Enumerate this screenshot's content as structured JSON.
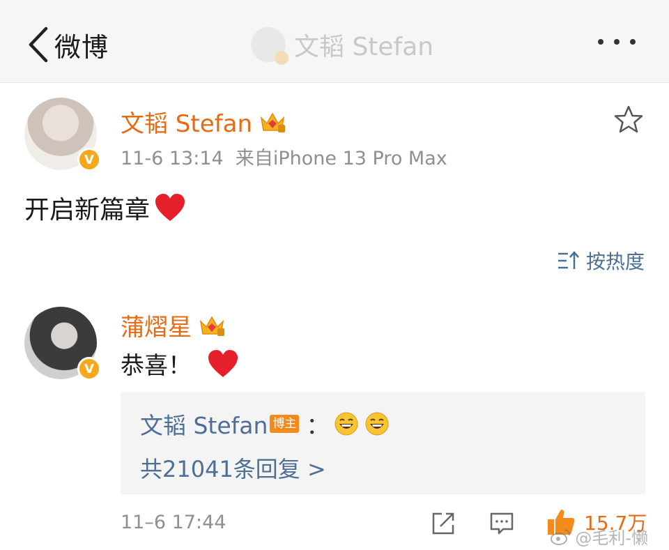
{
  "nav": {
    "back_label": "微博",
    "title": "文韬 Stefan"
  },
  "post": {
    "author": "文韬 Stefan",
    "time": "11-6 13:14",
    "source": "来自iPhone 13 Pro Max",
    "text": "开启新篇章"
  },
  "sort": {
    "label": "按热度"
  },
  "comment": {
    "author": "蒲熠星",
    "text": "恭喜！",
    "reply": {
      "author": "文韬 Stefan",
      "host_tag": "博主",
      "colon": "：",
      "count_text": "共21041条回复 >"
    },
    "time": "11–6 17:44",
    "likes": "15.7万"
  },
  "watermark": {
    "text": "@毛利-懒"
  },
  "colors": {
    "name_orange": "#e86a12",
    "link_blue": "#4d6e95",
    "verified": "#f6a81c"
  },
  "icons": [
    "chevron-left-icon",
    "more-dots-icon",
    "star-icon",
    "heart-icon",
    "sort-icon",
    "laugh-emoji-icon",
    "share-icon",
    "comment-icon",
    "thumbs-up-icon",
    "weibo-logo-icon"
  ]
}
